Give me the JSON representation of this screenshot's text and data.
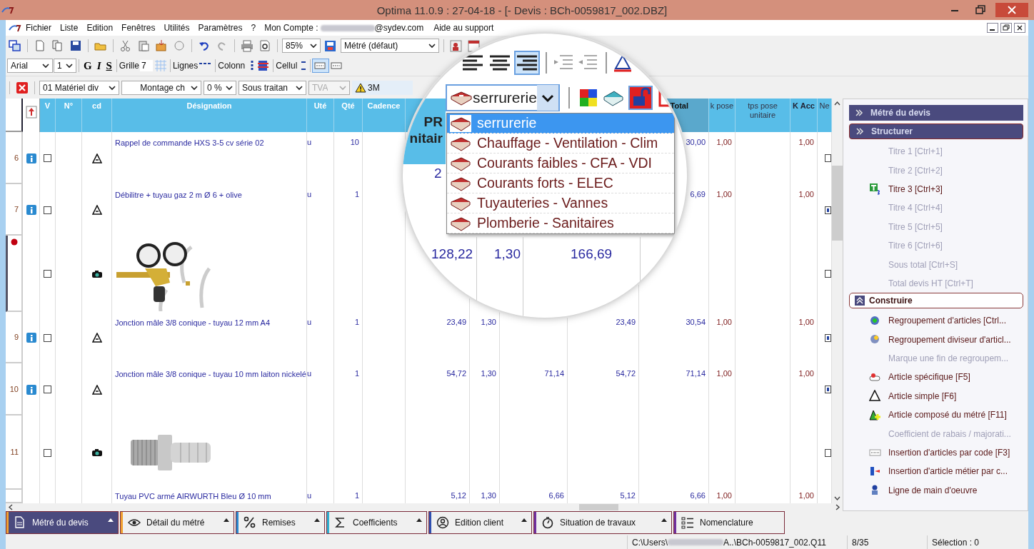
{
  "window": {
    "title": "Optima 11.0.9 : 27-04-18 - [- Devis : BCh-0059817_002.DBZ]"
  },
  "menu": {
    "items": [
      "Fichier",
      "Liste",
      "Edition",
      "Fenêtres",
      "Utilités",
      "Paramètres",
      "?"
    ],
    "account_label": "Mon Compte :",
    "account_email": "@sydev.com",
    "support": "Aide au support"
  },
  "toolbar_main": {
    "zoom": "85%",
    "view": "Métré (défaut)"
  },
  "toolbar_format": {
    "font": "Arial",
    "size": "1",
    "style_buttons": [
      "G",
      "I",
      "S"
    ],
    "grid_label": "Grille",
    "grid_value": "7",
    "lines_label": "Lignes",
    "columns_label": "Colonn",
    "cells_label": "Cellul",
    "row_toggles": [
      {
        "selected": true
      },
      {
        "selected": false
      }
    ]
  },
  "toolbar_filters": {
    "combos": [
      {
        "value": "01 Matériel div",
        "disabled": false
      },
      {
        "value": "Montage ch",
        "disabled": false
      },
      {
        "value": "0 %",
        "disabled": false
      },
      {
        "value": "Sous traitan",
        "disabled": false
      },
      {
        "value": "TVA",
        "disabled": true
      }
    ],
    "warning_field": "3M"
  },
  "table": {
    "columns": [
      "V",
      "N°",
      "cd",
      "Désignation",
      "Uté",
      "Qté",
      "Cadence",
      null,
      null,
      null,
      null,
      "Total",
      "k pose",
      "tps pose unitaire",
      "K Acc",
      "Ne"
    ],
    "rows": [
      {
        "kind": "article",
        "number": "6",
        "selected": false,
        "info": true,
        "checked": false,
        "designation": "Rappel de commande HXS 3-5 cv série 02",
        "unit": "u",
        "qty": "10",
        "values": {},
        "total": "30,00",
        "k_pose": "1,00",
        "k_acc": "1,00",
        "ne_checked": false
      },
      {
        "kind": "article",
        "number": "7",
        "selected": false,
        "info": true,
        "checked": false,
        "designation": "Débilitre + tuyau gaz 2 m Ø 6 + olive",
        "unit": "u",
        "qty": "1",
        "values": {},
        "total": "6,69",
        "k_pose": "1,00",
        "k_acc": "1,00",
        "ne_checked": true
      },
      {
        "selected": true,
        "info": false,
        "checked": false,
        "values": {},
        "ne_checked": false
      },
      {
        "kind": "article",
        "number": "9",
        "selected": false,
        "info": true,
        "checked": false,
        "designation": "Jonction mâle 3/8 conique - tuyau 12 mm A4",
        "unit": "u",
        "qty": "1",
        "values": {
          "column_10": "23,49",
          "column_11": "1,30",
          "column_13": "23,49"
        },
        "total": "30,54",
        "k_pose": "1,00",
        "k_acc": "1,00",
        "ne_checked": true
      },
      {
        "kind": "article",
        "number": "10",
        "selected": false,
        "info": true,
        "checked": false,
        "designation": "Jonction mâle 3/8 conique - tuyau 10 mm laiton nickelé",
        "unit": "u",
        "qty": "1",
        "values": {
          "column_10": "54,72",
          "column_11": "1,30",
          "column_12": "71,14",
          "column_13": "54,72"
        },
        "total": "71,14",
        "k_pose": "1,00",
        "k_acc": "1,00",
        "ne_checked": true
      },
      {
        "number": "11",
        "selected": false,
        "info": false,
        "checked": false,
        "values": {},
        "ne_checked": false
      },
      {
        "kind": "text",
        "selected": false,
        "info": false,
        "designation": "Tuyau PVC armé AIRWURTH Bleu Ø 10 mm",
        "unit": "u",
        "qty": "1",
        "values": {
          "column_10": "5,12",
          "column_11": "1,30",
          "column_12": "6,66",
          "column_13": "5,12"
        },
        "total": "6,66",
        "k_pose": "1,00",
        "k_acc": "1,00"
      }
    ]
  },
  "magnifier": {
    "align_buttons": [
      {
        "selected": false
      },
      {
        "selected": false
      },
      {
        "selected": true
      }
    ],
    "lock_selected": true,
    "combo_value": "serrurerie",
    "options": [
      {
        "label": "serrurerie",
        "selected": true
      },
      {
        "label": "Chauffage - Ventilation - Clim",
        "selected": false
      },
      {
        "label": "Courants faibles - CFA - VDI",
        "selected": false
      },
      {
        "label": "Courants forts - ELEC",
        "selected": false
      },
      {
        "label": "Tuyauteries - Vannes",
        "selected": false
      },
      {
        "label": "Plomberie - Sanitaires",
        "selected": false
      }
    ],
    "header_lines": [
      "PR",
      "nitair"
    ],
    "partial_value": "2",
    "values": [
      "128,22",
      "1,30",
      "166,69"
    ]
  },
  "side_panel": {
    "sections": [
      {
        "title": "Métré du devis",
        "kind": "bar",
        "expanded": false
      },
      {
        "title": "Structurer",
        "kind": "bar",
        "expanded": true,
        "items": [
          {
            "label": "Titre 1 [Ctrl+1]",
            "disabled": true
          },
          {
            "label": "Titre 2 [Ctrl+2]",
            "disabled": true
          },
          {
            "label": "Titre 3 [Ctrl+3]",
            "disabled": false
          },
          {
            "label": "Titre 4 [Ctrl+4]",
            "disabled": true
          },
          {
            "label": "Titre 5 [Ctrl+5]",
            "disabled": true
          },
          {
            "label": "Titre 6 [Ctrl+6]",
            "disabled": true
          },
          {
            "label": "Sous total [Ctrl+S]",
            "disabled": true
          },
          {
            "label": "Total devis HT [Ctrl+T]",
            "disabled": true
          }
        ]
      },
      {
        "title": "Construire",
        "kind": "outline",
        "expanded": true,
        "items": [
          {
            "label": "Regroupement d'articles  [Ctrl...",
            "disabled": false
          },
          {
            "label": "Regroupement diviseur d'articl...",
            "disabled": false
          },
          {
            "label": "Marque une fin de regroupem...",
            "disabled": true
          },
          {
            "label": "Article spécifique [F5]",
            "disabled": false
          },
          {
            "label": "Article simple [F6]",
            "disabled": false
          },
          {
            "label": "Article composé du métré [F11]",
            "disabled": false
          },
          {
            "label": "Coefficient de rabais / majorati...",
            "disabled": true
          },
          {
            "label": "Insertion d'articles par code [F3]",
            "disabled": false
          },
          {
            "label": "Insertion d'article métier par c...",
            "disabled": false
          },
          {
            "label": "Ligne de main d'oeuvre",
            "disabled": false
          }
        ]
      }
    ]
  },
  "bottom_tabs": [
    {
      "label": "Métré du devis",
      "selected": true,
      "color": "#f0a030",
      "menu": true
    },
    {
      "label": "Détail du métré",
      "selected": false,
      "color": "#f0a030",
      "menu": true
    },
    {
      "label": "Remises",
      "selected": false,
      "color": "#2a8ad0",
      "menu": true
    },
    {
      "label": "Coefficients",
      "selected": false,
      "color": "#30b0d0",
      "menu": true
    },
    {
      "label": "Edition client",
      "selected": false,
      "color": "#3050b0",
      "menu": true
    },
    {
      "label": "Situation de travaux",
      "selected": false,
      "color": "#7030a0",
      "menu": true
    },
    {
      "label": "Nomenclature",
      "selected": false,
      "color": "#7030a0",
      "menu": false
    }
  ],
  "status_bar": {
    "path_start": "C:\\Users\\",
    "path_end": "A..\\BCh-0059817_002.Q11",
    "page": "8/35",
    "selection": "Sélection : 0"
  }
}
